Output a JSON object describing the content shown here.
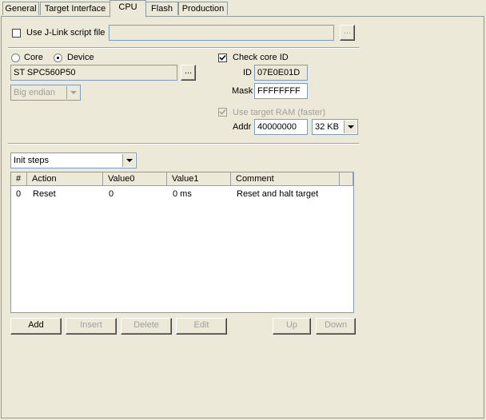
{
  "tabs": [
    {
      "label": "General"
    },
    {
      "label": "Target Interface"
    },
    {
      "label": "CPU"
    },
    {
      "label": "Flash"
    },
    {
      "label": "Production"
    }
  ],
  "script": {
    "label": "Use J-Link script file",
    "checked": false,
    "value": "",
    "browse": "..."
  },
  "core": {
    "radio_core": "Core",
    "radio_device": "Device",
    "selected": "Device",
    "device_value": "ST SPC560P50",
    "browse": "...",
    "endian": "Big endian"
  },
  "check_core": {
    "label": "Check core ID",
    "checked": true,
    "id_label": "ID",
    "id_value": "07E0E01D",
    "mask_label": "Mask",
    "mask_value": "FFFFFFFF"
  },
  "ram": {
    "label": "Use target RAM (faster)",
    "checked": true,
    "addr_label": "Addr",
    "addr_value": "40000000",
    "size_value": "32 KB"
  },
  "steps": {
    "dropdown": "Init steps",
    "columns": [
      "#",
      "Action",
      "Value0",
      "Value1",
      "Comment"
    ],
    "rows": [
      {
        "num": "0",
        "action": "Reset",
        "value0": "0",
        "value1": "0 ms",
        "comment": "Reset and halt target"
      }
    ]
  },
  "buttons": {
    "add": "Add",
    "insert": "Insert",
    "delete": "Delete",
    "edit": "Edit",
    "up": "Up",
    "down": "Down"
  }
}
